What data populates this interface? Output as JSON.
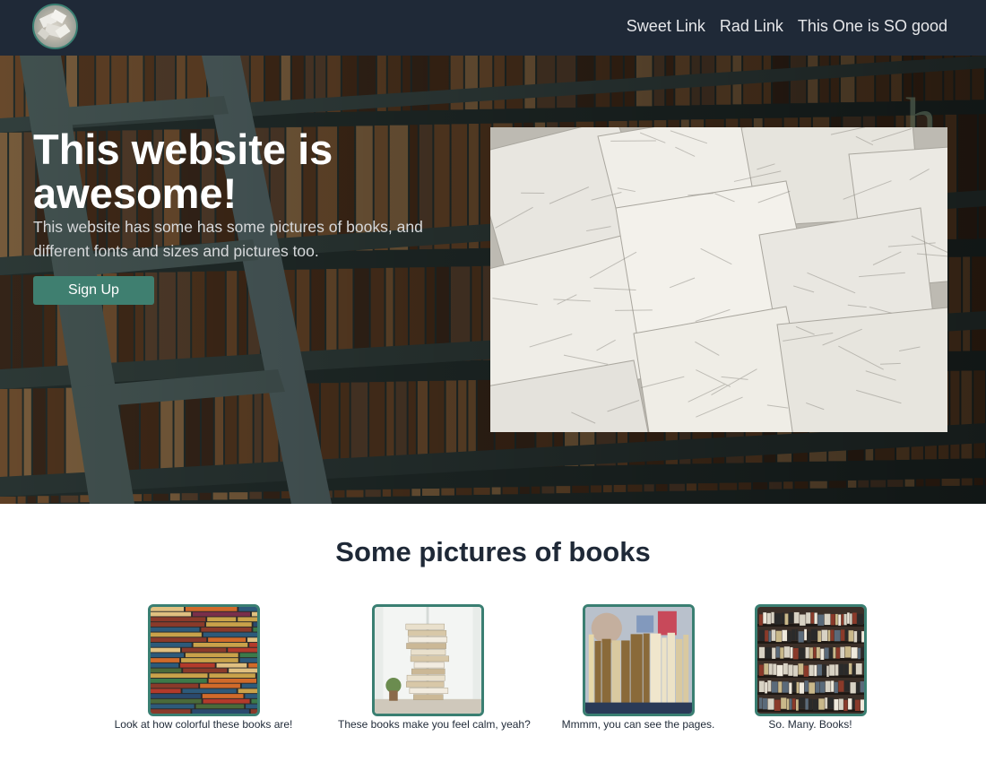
{
  "nav": {
    "logo": "books-logo",
    "links": [
      {
        "label": "Sweet Link"
      },
      {
        "label": "Rad Link"
      },
      {
        "label": "This One is SO good"
      }
    ]
  },
  "hero": {
    "title": "This website is awesome!",
    "description": "This website has some has some pictures of books, and different fonts and sizes and pictures too.",
    "cta_label": "Sign Up",
    "background": "library-bookshelves-photo",
    "image": "open-books-pile-photo"
  },
  "gallery": {
    "title": "Some pictures of books",
    "items": [
      {
        "image": "colorful-books-stack-photo",
        "caption": "Look at how colorful these books are!"
      },
      {
        "image": "books-by-window-photo",
        "caption": "These books make you feel calm, yeah?"
      },
      {
        "image": "book-spines-pages-photo",
        "caption": "Mmmm, you can see the pages."
      },
      {
        "image": "bookshelf-wall-photo",
        "caption": "So. Many. Books!"
      }
    ]
  },
  "colors": {
    "nav_bg": "#1f2937",
    "accent": "#3f7f70",
    "text_dark": "#1f2937"
  }
}
